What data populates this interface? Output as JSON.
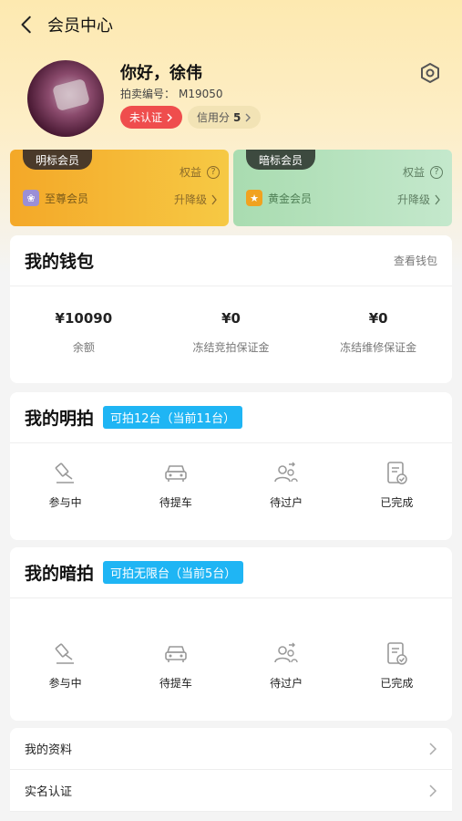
{
  "header": {
    "title": "会员中心"
  },
  "profile": {
    "greeting": "你好，徐伟",
    "auction_label": "拍卖编号：",
    "auction_no": "M19050",
    "verify_tag": "未认证",
    "credit_label": "信用分",
    "credit_value": "5"
  },
  "member_cards": {
    "left": {
      "tab": "明标会员",
      "rights": "权益",
      "level": "至尊会员",
      "upgrade": "升降级",
      "color": "#f4a828"
    },
    "right": {
      "tab": "暗标会员",
      "rights": "权益",
      "level": "黄金会员",
      "upgrade": "升降级",
      "color": "#a9dcb0"
    }
  },
  "wallet": {
    "title": "我的钱包",
    "link": "查看钱包",
    "items": [
      {
        "amount": "¥10090",
        "label": "余额"
      },
      {
        "amount": "¥0",
        "label": "冻结竞拍保证金"
      },
      {
        "amount": "¥0",
        "label": "冻结维修保证金"
      }
    ]
  },
  "open_auction": {
    "title": "我的明拍",
    "badge": "可拍12台（当前11台）",
    "items": [
      {
        "label": "参与中",
        "icon": "gavel-icon"
      },
      {
        "label": "待提车",
        "icon": "car-icon"
      },
      {
        "label": "待过户",
        "icon": "transfer-users-icon"
      },
      {
        "label": "已完成",
        "icon": "completed-doc-icon"
      }
    ]
  },
  "sealed_auction": {
    "title": "我的暗拍",
    "badge": "可拍无限台（当前5台）",
    "items": [
      {
        "label": "参与中",
        "icon": "gavel-icon"
      },
      {
        "label": "待提车",
        "icon": "car-icon"
      },
      {
        "label": "待过户",
        "icon": "transfer-users-icon"
      },
      {
        "label": "已完成",
        "icon": "completed-doc-icon"
      }
    ]
  },
  "menu": [
    {
      "label": "我的资料"
    },
    {
      "label": "实名认证"
    }
  ],
  "colors": {
    "badge_blue": "#1fb5f4",
    "tag_red": "#ef4d4d"
  }
}
